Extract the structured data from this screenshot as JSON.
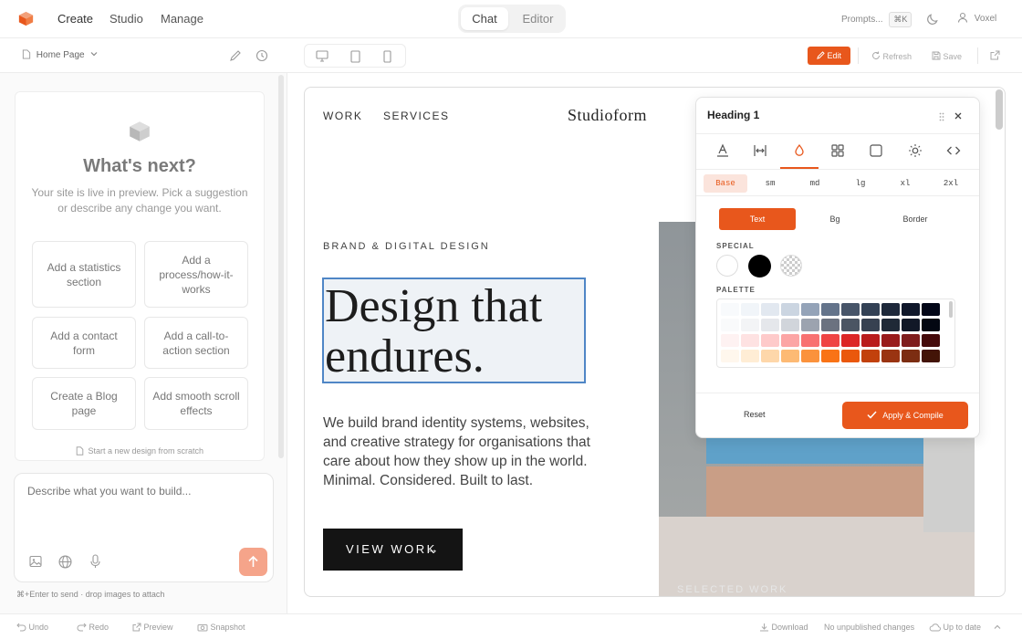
{
  "topbar": {
    "nav": [
      "Create",
      "Studio",
      "Manage"
    ],
    "mode_tabs": [
      "Chat",
      "Editor"
    ],
    "prompts_label": "Prompts...",
    "prompts_shortcut": "⌘K",
    "user_name": "Voxel"
  },
  "left": {
    "page_selector": "Home Page",
    "heading": "What's next?",
    "intro": "Your site is live in preview. Pick a suggestion or describe any change you want.",
    "suggestions": [
      "Add a statistics section",
      "Add a process/how-it-works",
      "Add a contact form",
      "Add a call-to-action section",
      "Create a Blog page",
      "Add smooth scroll effects"
    ],
    "new_design_link": "Start a new design from scratch",
    "composer_placeholder": "Describe what you want to build...",
    "hint": "⌘+Enter to send · drop images to attach"
  },
  "toolbar": {
    "edit": "Edit",
    "refresh": "Refresh",
    "save": "Save"
  },
  "site": {
    "nav": [
      "WORK",
      "SERVICES"
    ],
    "brand": "Studioform",
    "eyebrow": "BRAND & DIGITAL DESIGN",
    "headline_1": "Design that",
    "headline_2": "endures.",
    "body": "We build brand identity systems, websites, and creative strategy for organisations that care about how they show up in the world. Minimal. Considered. Built to last.",
    "cta": "VIEW WORK",
    "selected_label": "SELECTED WORK"
  },
  "inspector": {
    "title": "Heading 1",
    "breakpoints": [
      "Base",
      "sm",
      "md",
      "lg",
      "xl",
      "2xl"
    ],
    "color_targets": [
      "Text",
      "Bg",
      "Border"
    ],
    "special_label": "SPECIAL",
    "palette_label": "PALETTE",
    "reset": "Reset",
    "apply": "Apply & Compile"
  },
  "bottombar": {
    "undo": "Undo",
    "redo": "Redo",
    "preview": "Preview",
    "snapshot": "Snapshot",
    "download": "Download",
    "status": "No unpublished changes",
    "sync": "Up to date"
  },
  "colors": {
    "accent": "#e8571c",
    "text_dark": "#1d1d1d"
  }
}
